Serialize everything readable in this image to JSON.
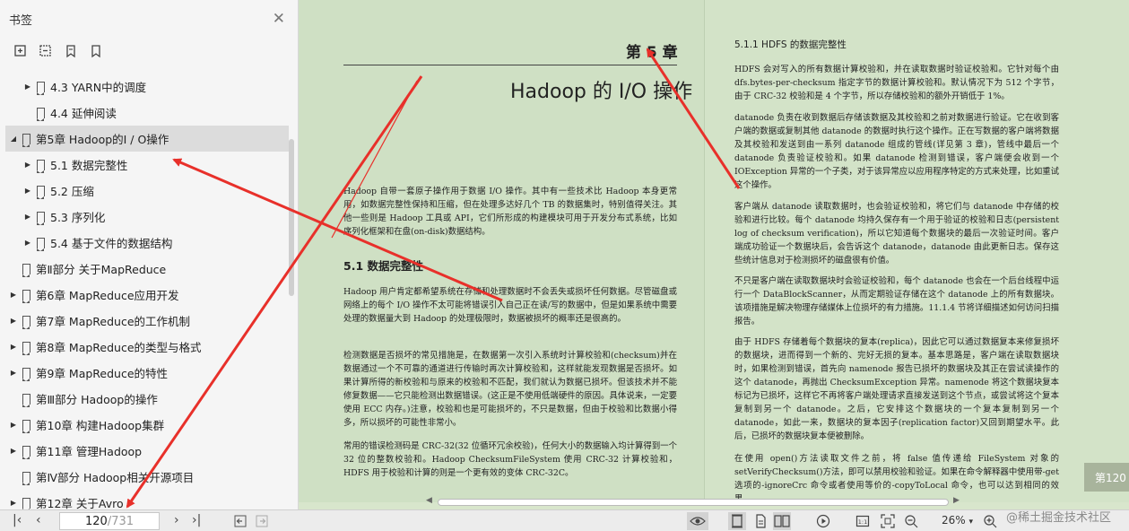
{
  "sidebar": {
    "title": "书签",
    "close_glyph": "✕",
    "tools": [
      "add-bookmark-icon",
      "delete-bookmark-icon",
      "bookmark-icon",
      "bookmark-outline-icon"
    ],
    "items": [
      {
        "label": "4.3 YARN中的调度",
        "level": 2,
        "expandable": true
      },
      {
        "label": "4.4 延伸阅读",
        "level": 2,
        "expandable": false
      },
      {
        "label": "第5章 Hadoop的I / O操作",
        "level": 1,
        "expandable": true,
        "expanded": true,
        "active": true
      },
      {
        "label": "5.1 数据完整性",
        "level": 2,
        "expandable": true
      },
      {
        "label": "5.2 压缩",
        "level": 2,
        "expandable": true
      },
      {
        "label": "5.3 序列化",
        "level": 2,
        "expandable": true
      },
      {
        "label": "5.4 基于文件的数据结构",
        "level": 2,
        "expandable": true
      },
      {
        "label": "第Ⅱ部分 关于MapReduce",
        "level": 1,
        "expandable": false
      },
      {
        "label": "第6章 MapReduce应用开发",
        "level": 1,
        "expandable": true
      },
      {
        "label": "第7章 MapReduce的工作机制",
        "level": 1,
        "expandable": true
      },
      {
        "label": "第8章 MapReduce的类型与格式",
        "level": 1,
        "expandable": true
      },
      {
        "label": "第9章 MapReduce的特性",
        "level": 1,
        "expandable": true
      },
      {
        "label": "第Ⅲ部分 Hadoop的操作",
        "level": 1,
        "expandable": false
      },
      {
        "label": "第10章 构建Hadoop集群",
        "level": 1,
        "expandable": true
      },
      {
        "label": "第11章 管理Hadoop",
        "level": 1,
        "expandable": true
      },
      {
        "label": "第Ⅳ部分 Hadoop相关开源项目",
        "level": 1,
        "expandable": false
      },
      {
        "label": "第12章 关于Avro",
        "level": 1,
        "expandable": true
      }
    ]
  },
  "doc": {
    "left": {
      "chapter_num": "第 5 章",
      "chapter_title": "Hadoop 的 I/O 操作",
      "intro": "Hadoop 自带一套原子操作用于数据 I/O 操作。其中有一些技术比 Hadoop 本身更常用，如数据完整性保持和压缩，但在处理多达好几个 TB 的数据集时，特别值得关注。其他一些则是 Hadoop 工具或 API，它们所形成的构建模块可用于开发分布式系统，比如序列化框架和在盘(on-disk)数据结构。",
      "section_title": "5.1   数据完整性",
      "para1": "Hadoop 用户肯定都希望系统在存储和处理数据时不会丢失或损坏任何数据。尽管磁盘或网络上的每个 I/O 操作不太可能将错误引入自己正在读/写的数据中，但是如果系统中需要处理的数据量大到 Hadoop 的处理极限时，数据被损坏的概率还是很高的。",
      "para2": "检测数据是否损坏的常见措施是，在数据第一次引入系统时计算校验和(checksum)并在数据通过一个不可靠的通道进行传输时再次计算校验和，这样就能发现数据是否损坏。如果计算所得的新校验和与原来的校验和不匹配，我们就认为数据已损坏。但该技术并不能修复数据——它只能检测出数据错误。(这正是不使用低端硬件的原因。具体说来，一定要使用 ECC 内存。)注意，校验和也是可能损坏的，不只是数据，但由于校验和比数据小得多，所以损坏的可能性非常小。",
      "para3": "常用的错误检测码是 CRC-32(32 位循环冗余校验)，任何大小的数据输入均计算得到一个 32 位的整数校验和。Hadoop ChecksumFileSystem 使用 CRC-32 计算校验和，HDFS 用于校验和计算的则是一个更有效的变体 CRC-32C。"
    },
    "right": {
      "subsection_title": "5.1.1   HDFS 的数据完整性",
      "para1": "HDFS 会对写入的所有数据计算校验和，并在读取数据时验证校验和。它针对每个由 dfs.bytes-per-checksum 指定字节的数据计算校验和。默认情况下为 512 个字节，由于 CRC-32 校验和是 4 个字节，所以存储校验和的额外开销低于 1%。",
      "para2": "datanode 负责在收到数据后存储该数据及其校验和之前对数据进行验证。它在收到客户端的数据或复制其他 datanode 的数据时执行这个操作。正在写数据的客户端将数据及其校验和发送到由一系列 datanode 组成的管线(详见第 3 章)，管线中最后一个 datanode 负责验证校验和。如果 datanode 检测到错误，客户端便会收到一个 IOException 异常的一个子类，对于该异常应以应用程序特定的方式来处理，比如重试这个操作。",
      "para3": "客户端从 datanode 读取数据时，也会验证校验和，将它们与 datanode 中存储的校验和进行比较。每个 datanode 均持久保存有一个用于验证的校验和日志(persistent log of checksum verification)，所以它知道每个数据块的最后一次验证时间。客户端成功验证一个数据块后，会告诉这个 datanode，datanode 由此更新日志。保存这些统计信息对于检测损坏的磁盘很有价值。",
      "para4": "不只是客户端在读取数据块时会验证校验和，每个 datanode 也会在一个后台线程中运行一个 DataBlockScanner，从而定期验证存储在这个 datanode 上的所有数据块。该项措施是解决物理存储媒体上位损坏的有力措施。11.1.4 节将详细描述如何访问扫描报告。",
      "para5": "由于 HDFS 存储着每个数据块的复本(replica)，因此它可以通过数据复本来修复损坏的数据块，进而得到一个新的、完好无损的复本。基本思路是，客户端在读取数据块时，如果检测到错误，首先向 namenode 报告已损坏的数据块及其正在尝试读操作的这个 datanode，再抛出 ChecksumException 异常。namenode 将这个数据块复本标记为已损坏，这样它不再将客户端处理请求直接发送到这个节点，或尝试将这个复本复制到另一个 datanode。之后，它安排这个数据块的一个复本复制到另一个 datanode，如此一来，数据块的复本因子(replication factor)又回到期望水平。此后，已损坏的数据块复本便被删除。",
      "para6": "在使用 open()方法读取文件之前，将 false 值传递给 FileSystem 对象的 setVerifyChecksum()方法，即可以禁用校验和验证。如果在命令解释器中使用带-get 选项的-ignoreCrc 命令或者使用等价的-copyToLocal 命令，也可以达到相同的效果。"
    },
    "page_badge": "第120"
  },
  "bottombar": {
    "first_page": "|‹",
    "prev_page": "‹",
    "current_page": "120",
    "total_pages": "/731",
    "next_page": "›",
    "last_page": "›|",
    "zoom": "26%",
    "zoom_caret": "▾"
  },
  "watermark": "@稀土掘金技术社区",
  "colors": {
    "page_bg": "#cfe0c4",
    "arrow": "#e8302a",
    "active_item": "#dcdcdc"
  }
}
